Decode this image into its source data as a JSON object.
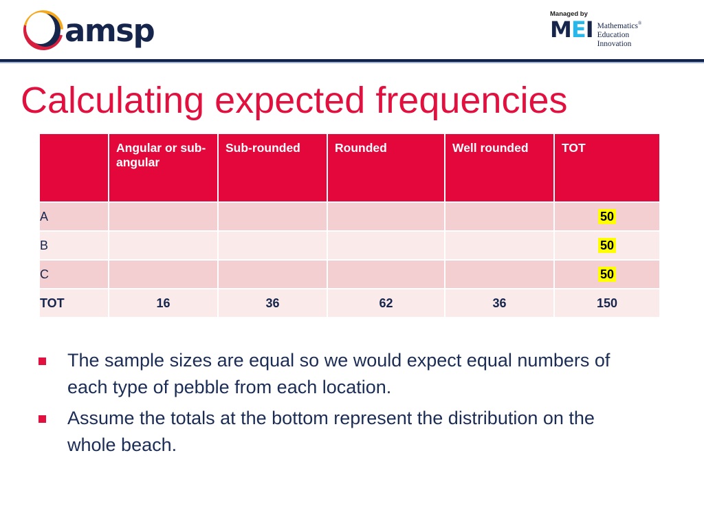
{
  "brand": {
    "amsp_name": "amsp",
    "amsp_logo_icon": "amsp-swirl-logo",
    "mei_managed_by": "Managed by",
    "mei_letters": {
      "m": "M",
      "e": "E",
      "i": "I"
    },
    "mei_tagline_line1": "Mathematics",
    "mei_tagline_registered": "®",
    "mei_tagline_line2": "Education",
    "mei_tagline_line3": "Innovation"
  },
  "slide": {
    "title": "Calculating expected frequencies"
  },
  "table": {
    "headers": [
      "",
      "Angular or sub-angular",
      "Sub-rounded",
      "Rounded",
      "Well rounded",
      "TOT"
    ],
    "rows": [
      {
        "label": "A",
        "cells": [
          "",
          "",
          "",
          ""
        ],
        "total": "50",
        "total_highlighted": true
      },
      {
        "label": "B",
        "cells": [
          "",
          "",
          "",
          ""
        ],
        "total": "50",
        "total_highlighted": true
      },
      {
        "label": "C",
        "cells": [
          "",
          "",
          "",
          ""
        ],
        "total": "50",
        "total_highlighted": true
      }
    ],
    "total_row": {
      "label": "TOT",
      "cells": [
        "16",
        "36",
        "62",
        "36"
      ],
      "total": "150"
    }
  },
  "bullets": [
    "The sample sizes are equal so we would expect equal numbers of each type of pebble from each location.",
    "Assume the totals at the bottom represent the distribution on the whole beach."
  ],
  "colors": {
    "title_red": "#e2103e",
    "table_header_red": "#e4073c",
    "row_dark_pink": "#f3cfd2",
    "row_light_pink": "#faeaea",
    "navy_text": "#1b2c55",
    "highlight_yellow": "#ffff00",
    "brand_navy": "#12224a",
    "mei_cyan": "#29b6e8",
    "logo_yellow": "#f5a81c",
    "logo_red": "#d81e3f"
  }
}
